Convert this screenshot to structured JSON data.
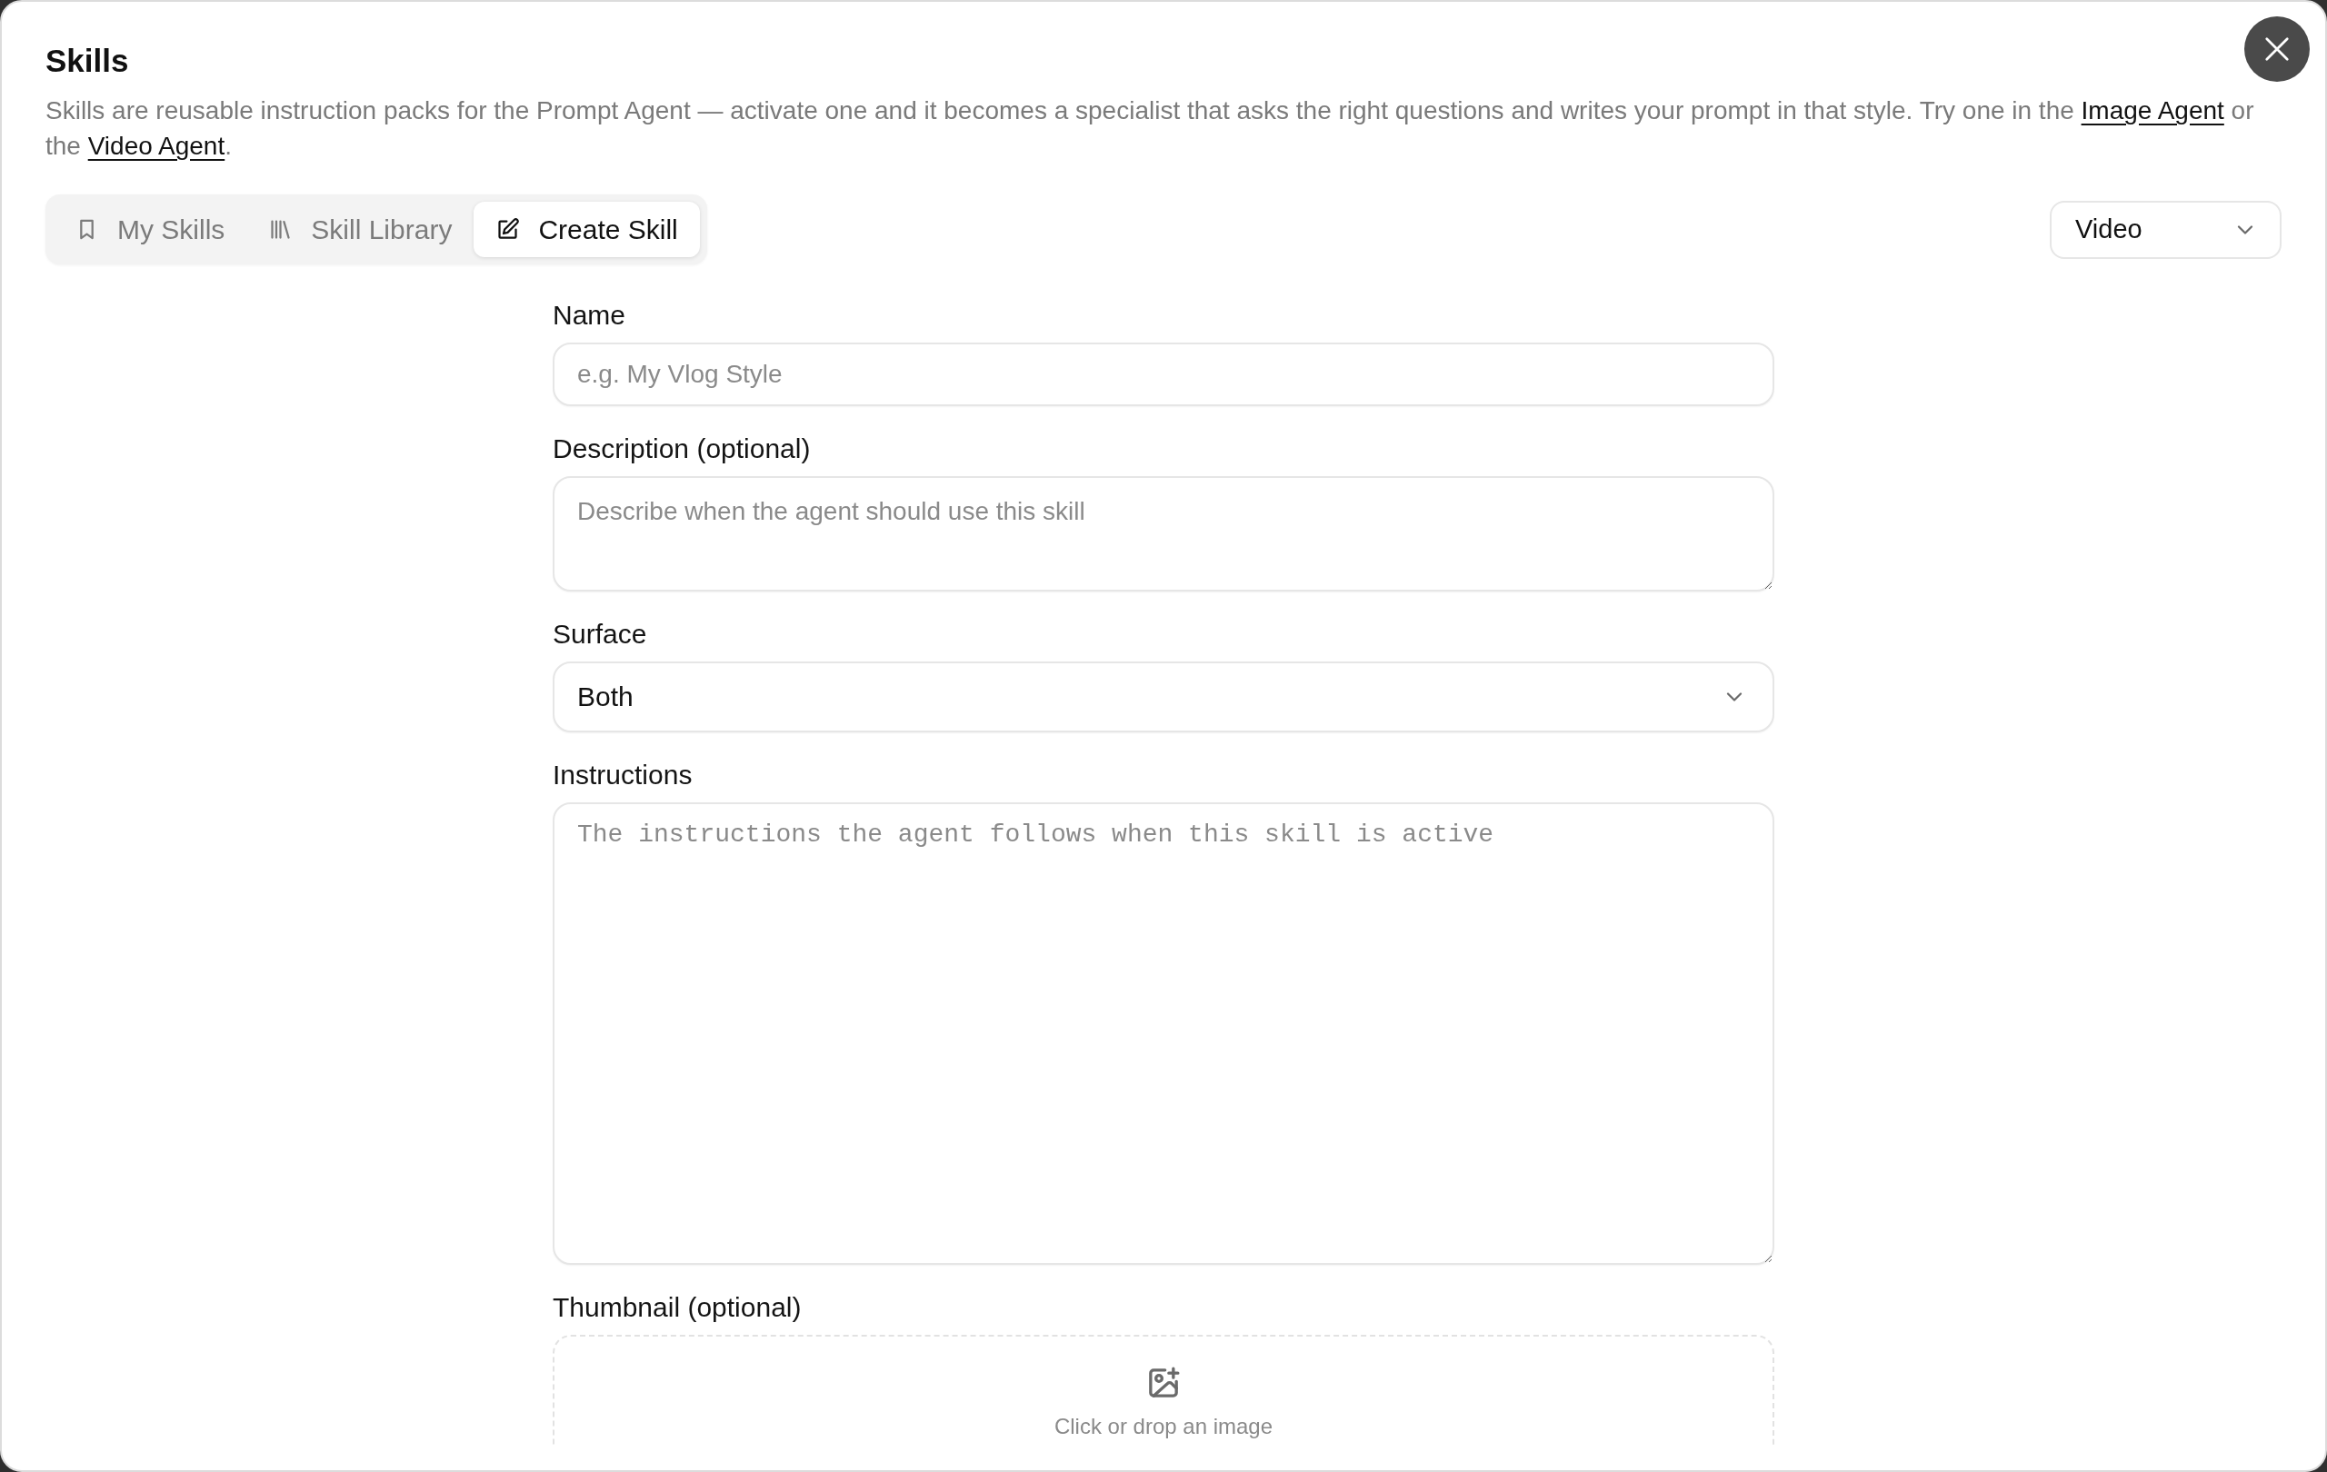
{
  "dialog": {
    "title": "Skills"
  },
  "description": [
    {
      "kind": "text",
      "text": "Skills are reusable instruction packs for the Prompt Agent — activate one and it becomes a specialist that asks the right questions and writes your prompt in that style. Try one in the "
    },
    {
      "kind": "link",
      "text": "Image Agent"
    },
    {
      "kind": "text",
      "text": " or the "
    },
    {
      "kind": "link",
      "text": "Video Agent"
    },
    {
      "kind": "text",
      "text": "."
    }
  ],
  "tabs": [
    {
      "label": "My Skills",
      "selected": false
    },
    {
      "label": "Skill Library",
      "selected": false
    },
    {
      "label": "Create Skill",
      "selected": true
    }
  ],
  "media_select": {
    "value": "Video"
  },
  "form": {
    "fields": [
      {
        "kind": "input",
        "label": "Name",
        "placeholder": "e.g. My Vlog Style"
      },
      {
        "kind": "textarea",
        "label": "Description (optional)",
        "placeholder": "Describe when the agent should use this skill"
      },
      {
        "kind": "select",
        "label": "Surface",
        "value": "Both"
      },
      {
        "kind": "codearea",
        "label": "Instructions",
        "placeholder": "The instructions the agent follows when this skill is active"
      },
      {
        "kind": "upload",
        "label": "Thumbnail (optional)",
        "prompt": "Click or drop an image"
      }
    ]
  }
}
